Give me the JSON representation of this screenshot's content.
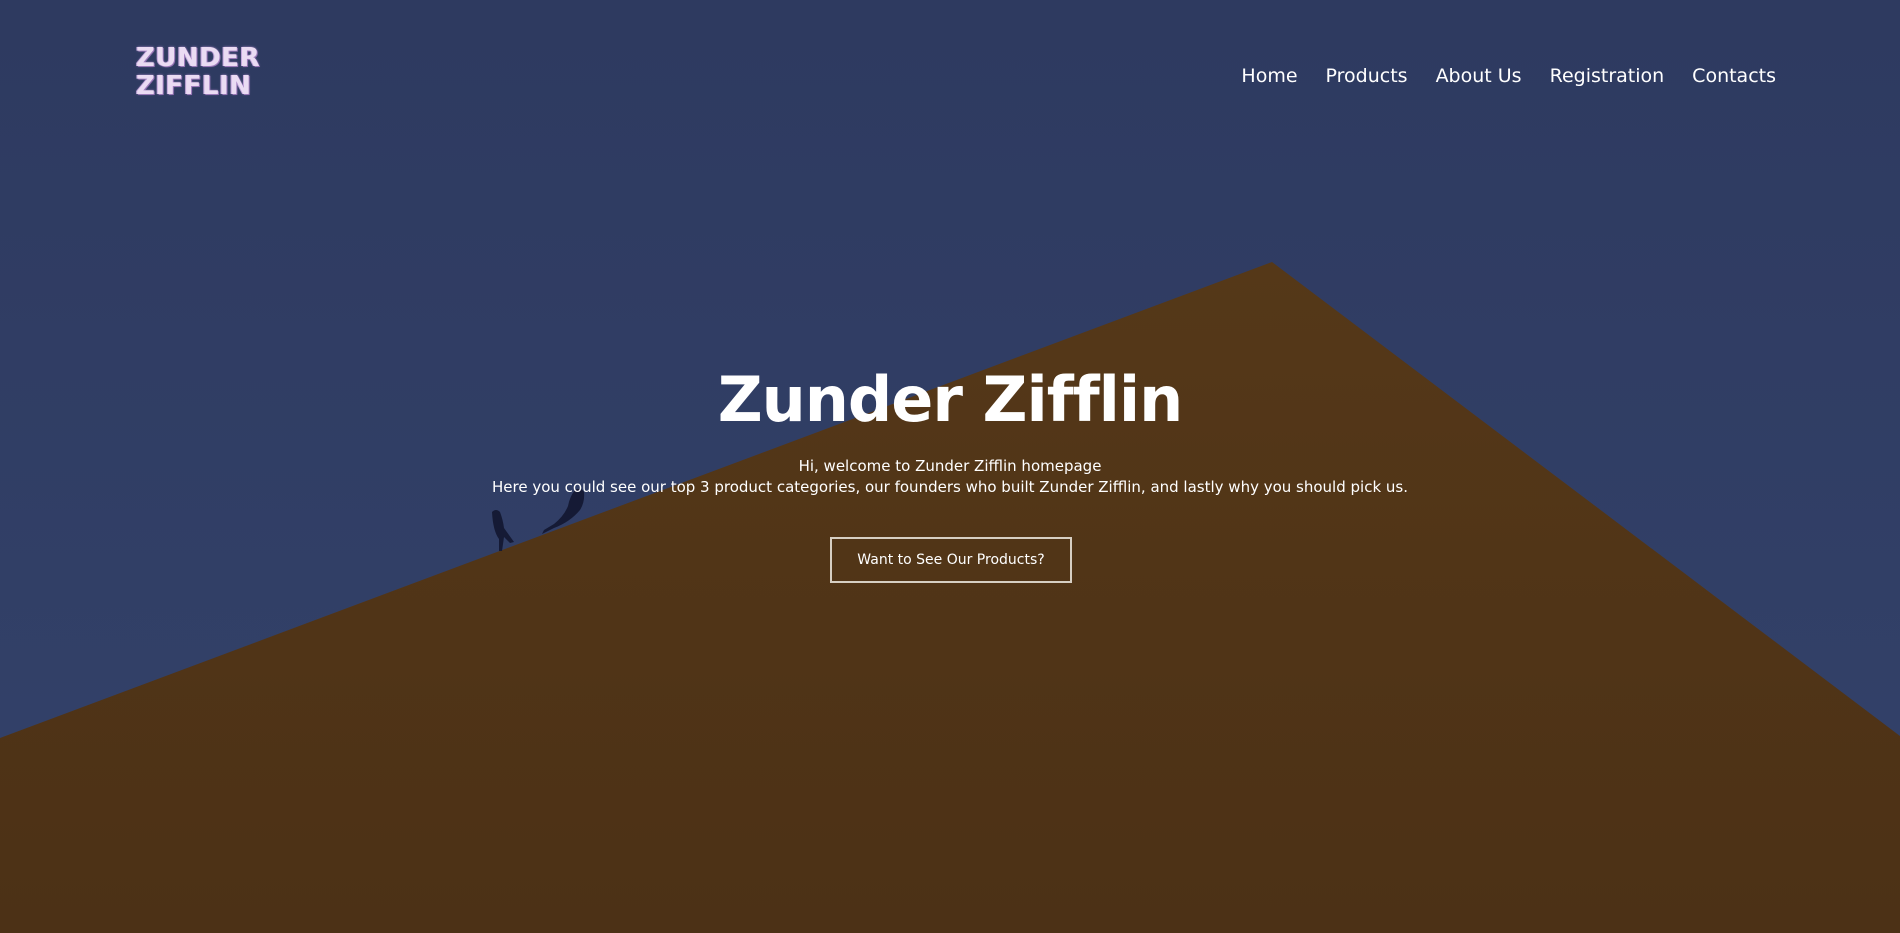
{
  "logo": {
    "line1": "ZUNDER",
    "line2": "ZIFFLIN"
  },
  "nav": {
    "items": [
      {
        "label": "Home"
      },
      {
        "label": "Products"
      },
      {
        "label": "About Us"
      },
      {
        "label": "Registration"
      },
      {
        "label": "Contacts"
      }
    ]
  },
  "hero": {
    "title": "Zunder Zifflin",
    "line1": "Hi, welcome to Zunder Zifflin homepage",
    "line2": "Here you could see our top 3 product categories, our founders who built Zunder Zifflin, and lastly why you should pick us.",
    "cta_label": "Want to See Our Products?"
  },
  "colors": {
    "sky": "#2f3c61",
    "wall": "#4f3317",
    "cta_border": "#d7cfc3",
    "text": "#ffffff"
  }
}
